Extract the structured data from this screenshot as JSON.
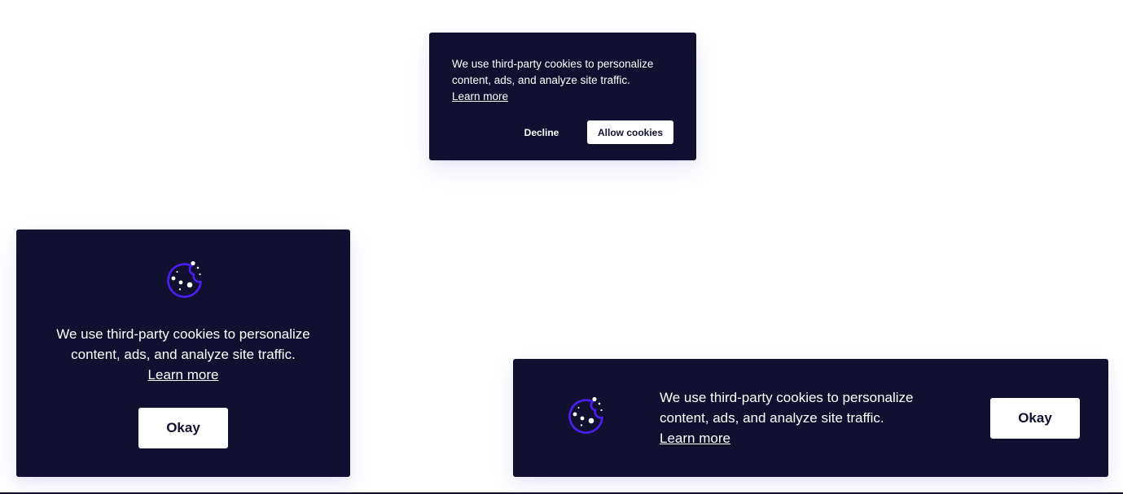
{
  "banner_top": {
    "message": "We use third-party cookies to personalize content, ads, and analyze site traffic.",
    "learn_more": "Learn more",
    "decline_label": "Decline",
    "allow_label": "Allow cookies"
  },
  "card_left": {
    "icon": "cookie-icon",
    "message": "We use third-party cookies to personalize content, ads, and analyze site traffic.",
    "learn_more": "Learn more",
    "okay_label": "Okay"
  },
  "banner_bottom": {
    "icon": "cookie-icon",
    "message": "We use third-party cookies to personalize content, ads, and analyze site traffic.",
    "learn_more": "Learn more",
    "okay_label": "Okay"
  },
  "colors": {
    "card_background": "#111030",
    "accent": "#4a1ff0",
    "button_background": "#ffffff",
    "button_text": "#111030"
  }
}
